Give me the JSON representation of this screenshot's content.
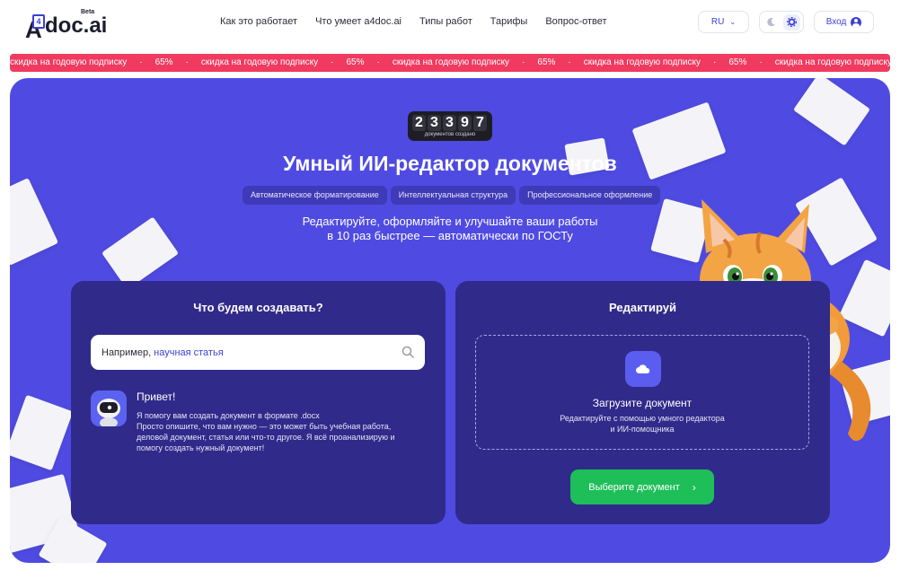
{
  "header": {
    "logo_text": "doc.ai",
    "logo_letter": "A",
    "logo_digit": "4",
    "beta": "Beta",
    "nav": [
      "Как это работает",
      "Что умеет a4doc.ai",
      "Типы работ",
      "Тарифы",
      "Вопрос-ответ"
    ],
    "lang": "RU",
    "login": "Вход"
  },
  "ticker": {
    "text": "скидка на годовую подписку",
    "percent": "65%",
    "separator": "·"
  },
  "hero": {
    "counter_digits": [
      "2",
      "3",
      "3",
      "9",
      "7"
    ],
    "counter_caption": "документов создано",
    "title": "Умный ИИ-редактор документов",
    "chips": [
      "Автоматическое форматирование",
      "Интеллектуальная структура",
      "Профессиональное оформление"
    ],
    "subtitle_line1": "Редактируйте, оформляйте и улучшайте ваши работы",
    "subtitle_line2": "в 10 раз быстрее — автоматически по ГОСТу"
  },
  "create_card": {
    "title": "Что будем создавать?",
    "search_prefix": "Например,",
    "search_example": "научная статья",
    "bot_greeting": "Привет!",
    "bot_line1": "Я помогу вам создать документ в формате .docx",
    "bot_line2": "Просто опишите, что вам нужно — это может быть учебная работа, деловой документ, статья или что-то другое. Я всё проанализирую и помогу создать нужный документ!"
  },
  "edit_card": {
    "title": "Редактируй",
    "upload_title": "Загрузите документ",
    "upload_line1": "Редактируйте с помощью умного редактора",
    "upload_line2": "и ИИ-помощника",
    "choose_button": "Выберите документ"
  },
  "colors": {
    "hero_bg": "#4f4be2",
    "card_bg": "#302b8a",
    "ticker_bg": "#f03a5f",
    "accent": "#3b3fd8",
    "cta": "#1ebe58"
  }
}
